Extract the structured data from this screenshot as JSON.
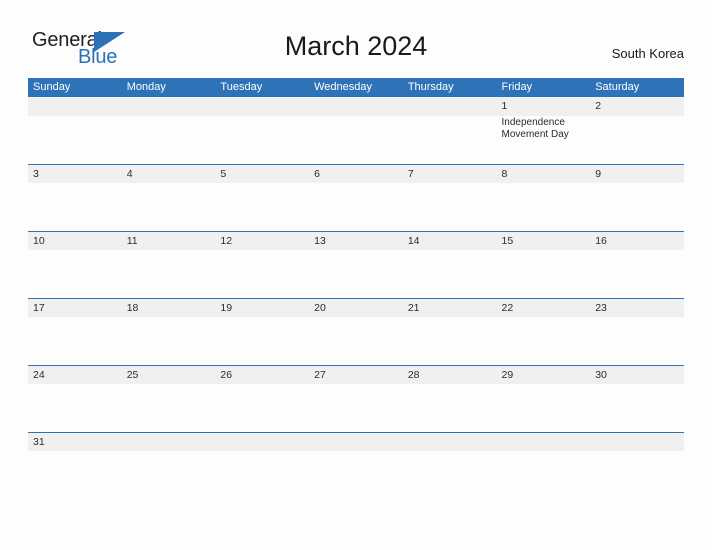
{
  "brand": {
    "name_part1": "General",
    "name_part2": "Blue",
    "triangle_icon": "triangle-icon",
    "color_primary": "#2a72b5",
    "color_text": "#231f20"
  },
  "header": {
    "title": "March 2024",
    "region": "South Korea"
  },
  "theme": {
    "header_blue": "#2e73b8",
    "band_gray": "#f0f0f0",
    "page_background": "#fdfdfd",
    "text_color": "#2b2b2b"
  },
  "calendar": {
    "month": "March",
    "year": "2024",
    "weekday_headers": [
      "Sunday",
      "Monday",
      "Tuesday",
      "Wednesday",
      "Thursday",
      "Friday",
      "Saturday"
    ],
    "weeks": [
      {
        "days": [
          {
            "num": "",
            "events": []
          },
          {
            "num": "",
            "events": []
          },
          {
            "num": "",
            "events": []
          },
          {
            "num": "",
            "events": []
          },
          {
            "num": "",
            "events": []
          },
          {
            "num": "1",
            "events": [
              "Independence Movement Day"
            ]
          },
          {
            "num": "2",
            "events": []
          }
        ]
      },
      {
        "days": [
          {
            "num": "3",
            "events": []
          },
          {
            "num": "4",
            "events": []
          },
          {
            "num": "5",
            "events": []
          },
          {
            "num": "6",
            "events": []
          },
          {
            "num": "7",
            "events": []
          },
          {
            "num": "8",
            "events": []
          },
          {
            "num": "9",
            "events": []
          }
        ]
      },
      {
        "days": [
          {
            "num": "10",
            "events": []
          },
          {
            "num": "11",
            "events": []
          },
          {
            "num": "12",
            "events": []
          },
          {
            "num": "13",
            "events": []
          },
          {
            "num": "14",
            "events": []
          },
          {
            "num": "15",
            "events": []
          },
          {
            "num": "16",
            "events": []
          }
        ]
      },
      {
        "days": [
          {
            "num": "17",
            "events": []
          },
          {
            "num": "18",
            "events": []
          },
          {
            "num": "19",
            "events": []
          },
          {
            "num": "20",
            "events": []
          },
          {
            "num": "21",
            "events": []
          },
          {
            "num": "22",
            "events": []
          },
          {
            "num": "23",
            "events": []
          }
        ]
      },
      {
        "days": [
          {
            "num": "24",
            "events": []
          },
          {
            "num": "25",
            "events": []
          },
          {
            "num": "26",
            "events": []
          },
          {
            "num": "27",
            "events": []
          },
          {
            "num": "28",
            "events": []
          },
          {
            "num": "29",
            "events": []
          },
          {
            "num": "30",
            "events": []
          }
        ]
      },
      {
        "last": true,
        "days": [
          {
            "num": "31",
            "events": []
          },
          {
            "num": "",
            "events": []
          },
          {
            "num": "",
            "events": []
          },
          {
            "num": "",
            "events": []
          },
          {
            "num": "",
            "events": []
          },
          {
            "num": "",
            "events": []
          },
          {
            "num": "",
            "events": []
          }
        ]
      }
    ]
  }
}
